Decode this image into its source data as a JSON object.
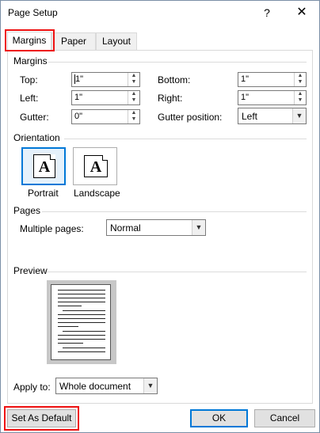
{
  "window": {
    "title": "Page Setup",
    "help": "?",
    "close": "✕"
  },
  "tabs": [
    {
      "label": "Margins"
    },
    {
      "label": "Paper"
    },
    {
      "label": "Layout"
    }
  ],
  "margins": {
    "group": "Margins",
    "top": {
      "label": "Top:",
      "value": "1\""
    },
    "bottom": {
      "label": "Bottom:",
      "value": "1\""
    },
    "left": {
      "label": "Left:",
      "value": "1\""
    },
    "right": {
      "label": "Right:",
      "value": "1\""
    },
    "gutter": {
      "label": "Gutter:",
      "value": "0\""
    },
    "gutter_position": {
      "label": "Gutter position:",
      "value": "Left"
    }
  },
  "orientation": {
    "group": "Orientation",
    "portrait": {
      "label": "Portrait",
      "glyph": "A"
    },
    "landscape": {
      "label": "Landscape",
      "glyph": "A"
    },
    "selected": "portrait"
  },
  "pages": {
    "group": "Pages",
    "multiple_label": "Multiple pages:",
    "multiple_value": "Normal"
  },
  "preview": {
    "group": "Preview"
  },
  "apply": {
    "label": "Apply to:",
    "value": "Whole document"
  },
  "buttons": {
    "set_default": "Set As Default",
    "ok": "OK",
    "cancel": "Cancel"
  },
  "colors": {
    "highlight": "#e11111",
    "accent": "#0078d7"
  }
}
